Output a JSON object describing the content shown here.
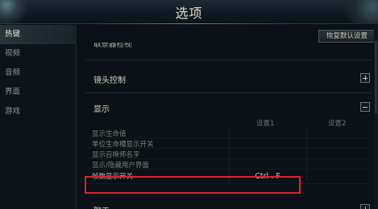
{
  "window": {
    "title": "选项"
  },
  "sidebar": {
    "items": [
      {
        "label": "热键",
        "active": true
      },
      {
        "label": "视频",
        "active": false
      },
      {
        "label": "音频",
        "active": false
      },
      {
        "label": "界面",
        "active": false
      },
      {
        "label": "游戏",
        "active": false
      }
    ]
  },
  "toolbar": {
    "reset_label": "恢复默认设置"
  },
  "sections": {
    "cut_top_label": "取景器检视",
    "camera_control": {
      "label": "镜头控制",
      "collapsed": true
    },
    "display": {
      "label": "显示",
      "collapsed": false,
      "columns": [
        "设置1",
        "设置2"
      ],
      "rows": [
        {
          "name": "显示生命值",
          "key1": "",
          "key2": ""
        },
        {
          "name": "单位生命槽显示开关",
          "key1": "",
          "key2": ""
        },
        {
          "name": "显示召唤师名字",
          "key1": "",
          "key2": ""
        },
        {
          "name": "显示/隐藏用户界面",
          "key1": "",
          "key2": ""
        },
        {
          "name": "帧数显示开关",
          "key1": "Ctrl . F",
          "key2": ""
        }
      ]
    },
    "cut_bottom_label": "聊天"
  },
  "colors": {
    "highlight_border": "#d8262b",
    "active_text": "#e8e2cf"
  }
}
